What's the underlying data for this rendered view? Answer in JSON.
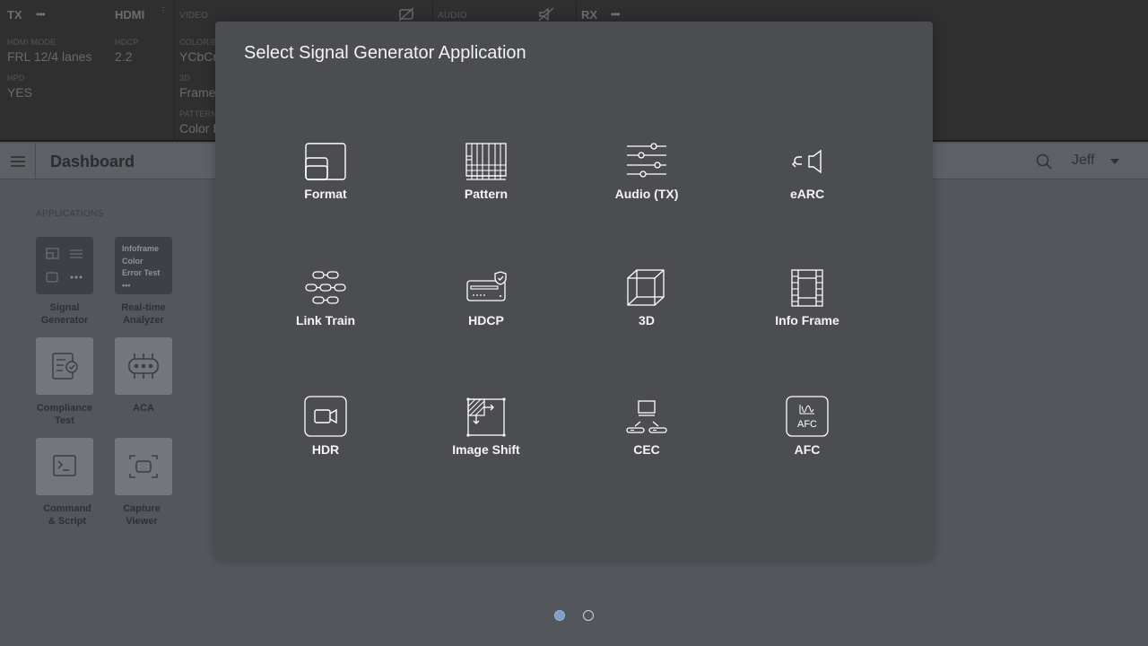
{
  "topbar": {
    "tx": {
      "title": "TX",
      "hdmi_mode_label": "HDMI MODE",
      "hdmi_mode_value": "FRL 12/4 lanes",
      "hpd_label": "HPD",
      "hpd_value": "YES"
    },
    "hdmi": {
      "title": "HDMI",
      "hdcp_label": "HDCP",
      "hdcp_value": "2.2"
    },
    "video": {
      "title": "VIDEO",
      "color_label": "COLOR/B",
      "color_value": "YCbCr",
      "three_d_label": "3D",
      "three_d_value": "Frame",
      "pattern_label": "PATTERN",
      "pattern_value": "Color B"
    },
    "audio": {
      "title": "AUDIO"
    },
    "rx": {
      "title": "RX"
    },
    "more_glyph": "•••"
  },
  "appbar": {
    "title": "Dashboard",
    "user": "Jeff"
  },
  "dashboard": {
    "section_label": "APPLICATIONS",
    "tiles": [
      {
        "caption_line1": "Signal",
        "caption_line2": "Generator"
      },
      {
        "caption_line1": "Real-time",
        "caption_line2": "Analyzer",
        "lines": [
          "Infoframe",
          "Color",
          "Error Test",
          "•••"
        ]
      },
      {
        "caption_line1": "Compliance",
        "caption_line2": "Test"
      },
      {
        "caption_line1": "ACA",
        "caption_line2": ""
      },
      {
        "caption_line1": "Command",
        "caption_line2": "& Script"
      },
      {
        "caption_line1": "Capture",
        "caption_line2": "Viewer"
      }
    ]
  },
  "modal": {
    "title": "Select Signal Generator Application",
    "apps": [
      {
        "label": "Format",
        "icon": "format-icon"
      },
      {
        "label": "Pattern",
        "icon": "pattern-icon"
      },
      {
        "label": "Audio (TX)",
        "icon": "audio-sliders-icon"
      },
      {
        "label": "eARC",
        "icon": "earc-speaker-icon"
      },
      {
        "label": "Link Train",
        "icon": "link-train-icon"
      },
      {
        "label": "HDCP",
        "icon": "hdcp-shield-icon"
      },
      {
        "label": "3D",
        "icon": "cube-icon"
      },
      {
        "label": "Info Frame",
        "icon": "film-frame-icon"
      },
      {
        "label": "HDR",
        "icon": "camera-icon"
      },
      {
        "label": "Image Shift",
        "icon": "image-shift-icon"
      },
      {
        "label": "CEC",
        "icon": "cec-network-icon"
      },
      {
        "label": "AFC",
        "icon": "afc-icon",
        "icon_text": "AFC"
      }
    ]
  },
  "pager": {
    "pages": 2,
    "current": 1
  },
  "colors": {
    "modal_bg": "#4c4d50",
    "page_bg": "#53575c",
    "topbar_bg": "#2f2f2f",
    "pager_active": "#7f9fc6"
  }
}
